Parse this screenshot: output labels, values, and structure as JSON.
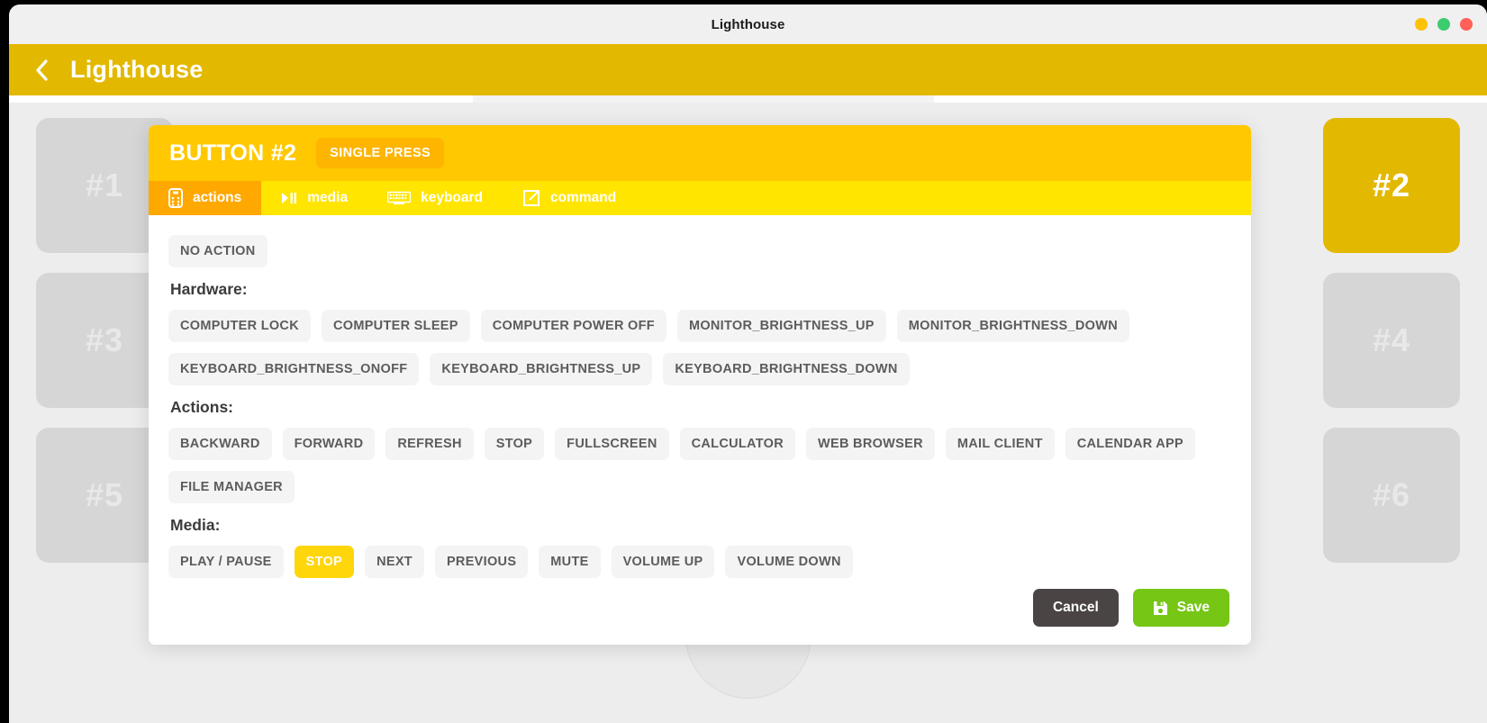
{
  "window": {
    "title": "Lighthouse",
    "controls": [
      {
        "name": "minimize",
        "color": "#ffc107"
      },
      {
        "name": "maximize",
        "color": "#3dcc6e"
      },
      {
        "name": "close",
        "color": "#ff6058"
      }
    ]
  },
  "header": {
    "back_icon": "chevron-left-icon",
    "title": "Lighthouse",
    "accent": "#e3b800"
  },
  "grid": {
    "left_cards": [
      {
        "label": "#1",
        "selected": false
      },
      {
        "label": "#3",
        "selected": false
      },
      {
        "label": "#5",
        "selected": false
      }
    ],
    "right_cards": [
      {
        "label": "#2",
        "selected": true
      },
      {
        "label": "#4",
        "selected": false
      },
      {
        "label": "#6",
        "selected": false
      }
    ]
  },
  "modal": {
    "title": "BUTTON #2",
    "press_badge": "SINGLE PRESS",
    "tabs": [
      {
        "label": "actions",
        "icon": "remote-control-icon",
        "active": true
      },
      {
        "label": "media",
        "icon": "play-pause-icon",
        "active": false
      },
      {
        "label": "keyboard",
        "icon": "keyboard-icon",
        "active": false
      },
      {
        "label": "command",
        "icon": "external-link-icon",
        "active": false
      }
    ],
    "no_action_label": "NO ACTION",
    "sections": [
      {
        "label": "Hardware:",
        "chips": [
          "COMPUTER LOCK",
          "COMPUTER SLEEP",
          "COMPUTER POWER OFF",
          "MONITOR_BRIGHTNESS_UP",
          "MONITOR_BRIGHTNESS_DOWN",
          "KEYBOARD_BRIGHTNESS_ONOFF",
          "KEYBOARD_BRIGHTNESS_UP",
          "KEYBOARD_BRIGHTNESS_DOWN"
        ],
        "selected": null
      },
      {
        "label": "Actions:",
        "chips": [
          "BACKWARD",
          "FORWARD",
          "REFRESH",
          "STOP",
          "FULLSCREEN",
          "CALCULATOR",
          "WEB BROWSER",
          "MAIL CLIENT",
          "CALENDAR APP",
          "FILE MANAGER"
        ],
        "selected": null
      },
      {
        "label": "Media:",
        "chips": [
          "PLAY / PAUSE",
          "STOP",
          "NEXT",
          "PREVIOUS",
          "MUTE",
          "VOLUME UP",
          "VOLUME DOWN"
        ],
        "selected": "STOP"
      }
    ],
    "cancel_label": "Cancel",
    "save_label": "Save",
    "save_icon": "floppy-save-icon",
    "colors": {
      "header": "#ffc800",
      "badge": "#fdb500",
      "tabbar": "#ffe500",
      "tab_active": "#ffa800",
      "chip_bg": "#f4f4f4",
      "chip_text": "#5c5c5c",
      "chip_selected_bg": "#ffd60a",
      "cancel_bg": "#4a4544",
      "save_bg": "#76c616"
    }
  }
}
